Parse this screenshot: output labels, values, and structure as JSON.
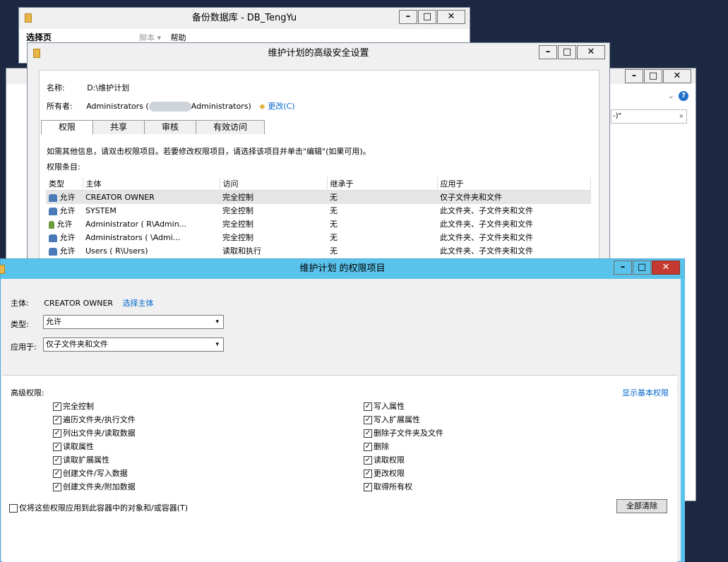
{
  "backup_window": {
    "title": "备份数据库 - DB_TengYu",
    "select_page": "选择页",
    "toolbar_script": "脚本 ▾",
    "toolbar_help": "帮助"
  },
  "explorer_window": {
    "search_placeholder": "-)\""
  },
  "advsec_window": {
    "title": "维护计划的高级安全设置",
    "name_label": "名称:",
    "name_value": "D:\\维护计划",
    "owner_label": "所有者:",
    "owner_value_start": "Administrators (",
    "owner_value_end": "Administrators)",
    "change_link": "更改(C)",
    "tabs": [
      "权限",
      "共享",
      "审核",
      "有效访问"
    ],
    "info_text": "如需其他信息，请双击权限项目。若要修改权限项目，请选择该项目并单击\"编辑\"(如果可用)。",
    "entries_label": "权限条目:",
    "columns": [
      "类型",
      "主体",
      "访问",
      "继承于",
      "应用于"
    ],
    "rows": [
      {
        "type": "允许",
        "principal": "CREATOR OWNER",
        "access": "完全控制",
        "inherit": "无",
        "applies": "仅子文件夹和文件"
      },
      {
        "type": "允许",
        "principal": "SYSTEM",
        "access": "完全控制",
        "inherit": "无",
        "applies": "此文件夹、子文件夹和文件"
      },
      {
        "type": "允许",
        "principal": "Administrator (          R\\Admin...",
        "access": "完全控制",
        "inherit": "无",
        "applies": "此文件夹、子文件夹和文件"
      },
      {
        "type": "允许",
        "principal": "Administrators (          \\Admi...",
        "access": "完全控制",
        "inherit": "无",
        "applies": "此文件夹、子文件夹和文件"
      },
      {
        "type": "允许",
        "principal": "Users (          R\\Users)",
        "access": "读取和执行",
        "inherit": "无",
        "applies": "此文件夹、子文件夹和文件"
      }
    ]
  },
  "entry_window": {
    "title": "维护计划 的权限项目",
    "principal_label": "主体:",
    "principal_value": "CREATOR OWNER",
    "select_principal_link": "选择主体",
    "type_label": "类型:",
    "type_value": "允许",
    "applies_label": "应用于:",
    "applies_value": "仅子文件夹和文件",
    "advanced_label": "高级权限:",
    "show_basic_link": "显示基本权限",
    "perms_left": [
      "完全控制",
      "遍历文件夹/执行文件",
      "列出文件夹/读取数据",
      "读取属性",
      "读取扩展属性",
      "创建文件/写入数据",
      "创建文件夹/附加数据"
    ],
    "perms_right": [
      "写入属性",
      "写入扩展属性",
      "删除子文件夹及文件",
      "删除",
      "读取权限",
      "更改权限",
      "取得所有权"
    ],
    "apply_only_label": "仅将这些权限应用到此容器中的对象和/或容器(T)",
    "clear_all_button": "全部清除"
  }
}
